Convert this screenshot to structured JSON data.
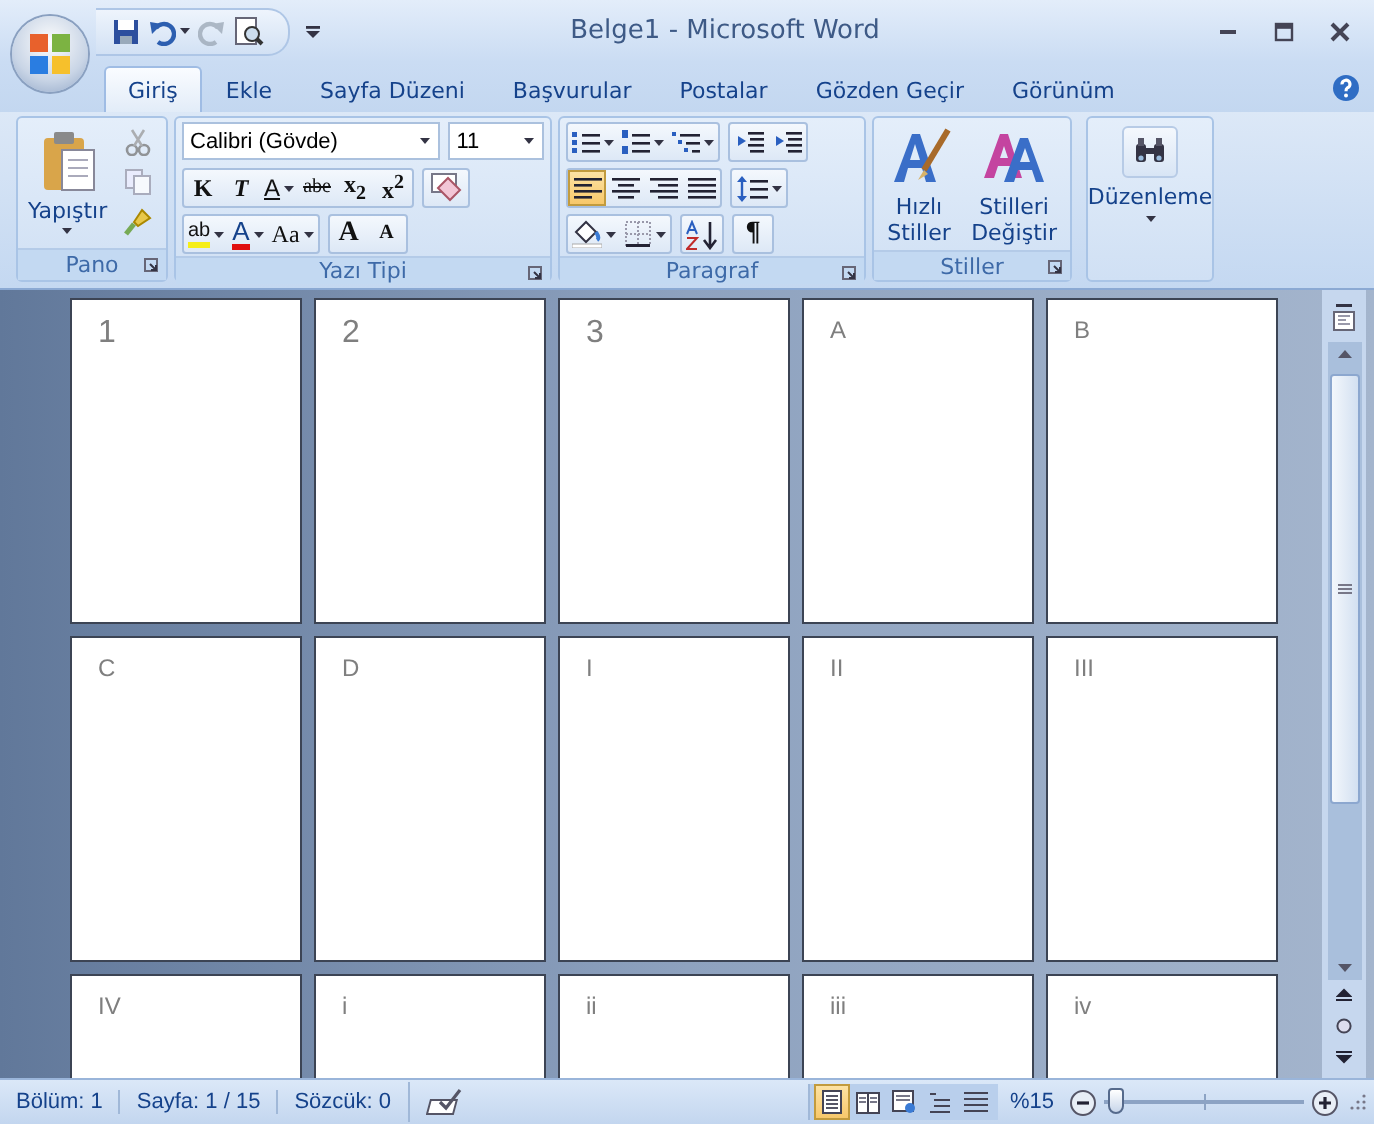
{
  "window": {
    "title": "Belge1 - Microsoft Word"
  },
  "tabs": [
    {
      "label": "Giriş",
      "selected": true
    },
    {
      "label": "Ekle",
      "selected": false
    },
    {
      "label": "Sayfa Düzeni",
      "selected": false
    },
    {
      "label": "Başvurular",
      "selected": false
    },
    {
      "label": "Postalar",
      "selected": false
    },
    {
      "label": "Gözden Geçir",
      "selected": false
    },
    {
      "label": "Görünüm",
      "selected": false
    }
  ],
  "ribbon": {
    "clipboard": {
      "paste": "Yapıştır",
      "label": "Pano"
    },
    "font": {
      "family": "Calibri (Gövde)",
      "size": "11",
      "format_buttons": [
        {
          "text": "K"
        },
        {
          "text": "T"
        },
        {
          "text": "A"
        },
        {
          "text": "abe"
        },
        {
          "text": "x$_{2}$"
        },
        {
          "text": "x$^{2}$"
        }
      ],
      "highlight": "ab",
      "font_color": "A",
      "change_case": "Aa",
      "grow": "A",
      "shrink": "A",
      "label": "Yazı Tipi"
    },
    "paragraph": {
      "alignment": [
        {
          "selected": true
        },
        {
          "selected": false
        },
        {
          "selected": false
        },
        {
          "selected": false
        }
      ],
      "pilcrow": "¶",
      "label": "Paragraf"
    },
    "styles": {
      "quick": "Hızlı\nStiller",
      "change": "Stilleri\nDeğiştir",
      "label": "Stiller"
    },
    "editing": {
      "label": "Düzenleme"
    }
  },
  "pages": [
    {
      "label": "1",
      "kind": "big"
    },
    {
      "label": "2",
      "kind": "big"
    },
    {
      "label": "3",
      "kind": "big"
    },
    {
      "label": "A",
      "kind": "small"
    },
    {
      "label": "B",
      "kind": "small"
    },
    {
      "label": "C",
      "kind": "small"
    },
    {
      "label": "D",
      "kind": "small"
    },
    {
      "label": "I",
      "kind": "small"
    },
    {
      "label": "II",
      "kind": "small"
    },
    {
      "label": "III",
      "kind": "small"
    },
    {
      "label": "IV",
      "kind": "small"
    },
    {
      "label": "i",
      "kind": "small"
    },
    {
      "label": "ii",
      "kind": "small"
    },
    {
      "label": "iii",
      "kind": "small"
    },
    {
      "label": "iv",
      "kind": "small"
    }
  ],
  "status_bar": {
    "section": "Bölüm: 1",
    "page": "Sayfa: 1 / 15",
    "words": "Sözcük: 0",
    "views": [
      {
        "selected": true
      },
      {
        "selected": false
      },
      {
        "selected": false
      },
      {
        "selected": false
      },
      {
        "selected": false
      }
    ],
    "zoom": "%15",
    "zoom_slider": {
      "level": 0.06
    }
  }
}
